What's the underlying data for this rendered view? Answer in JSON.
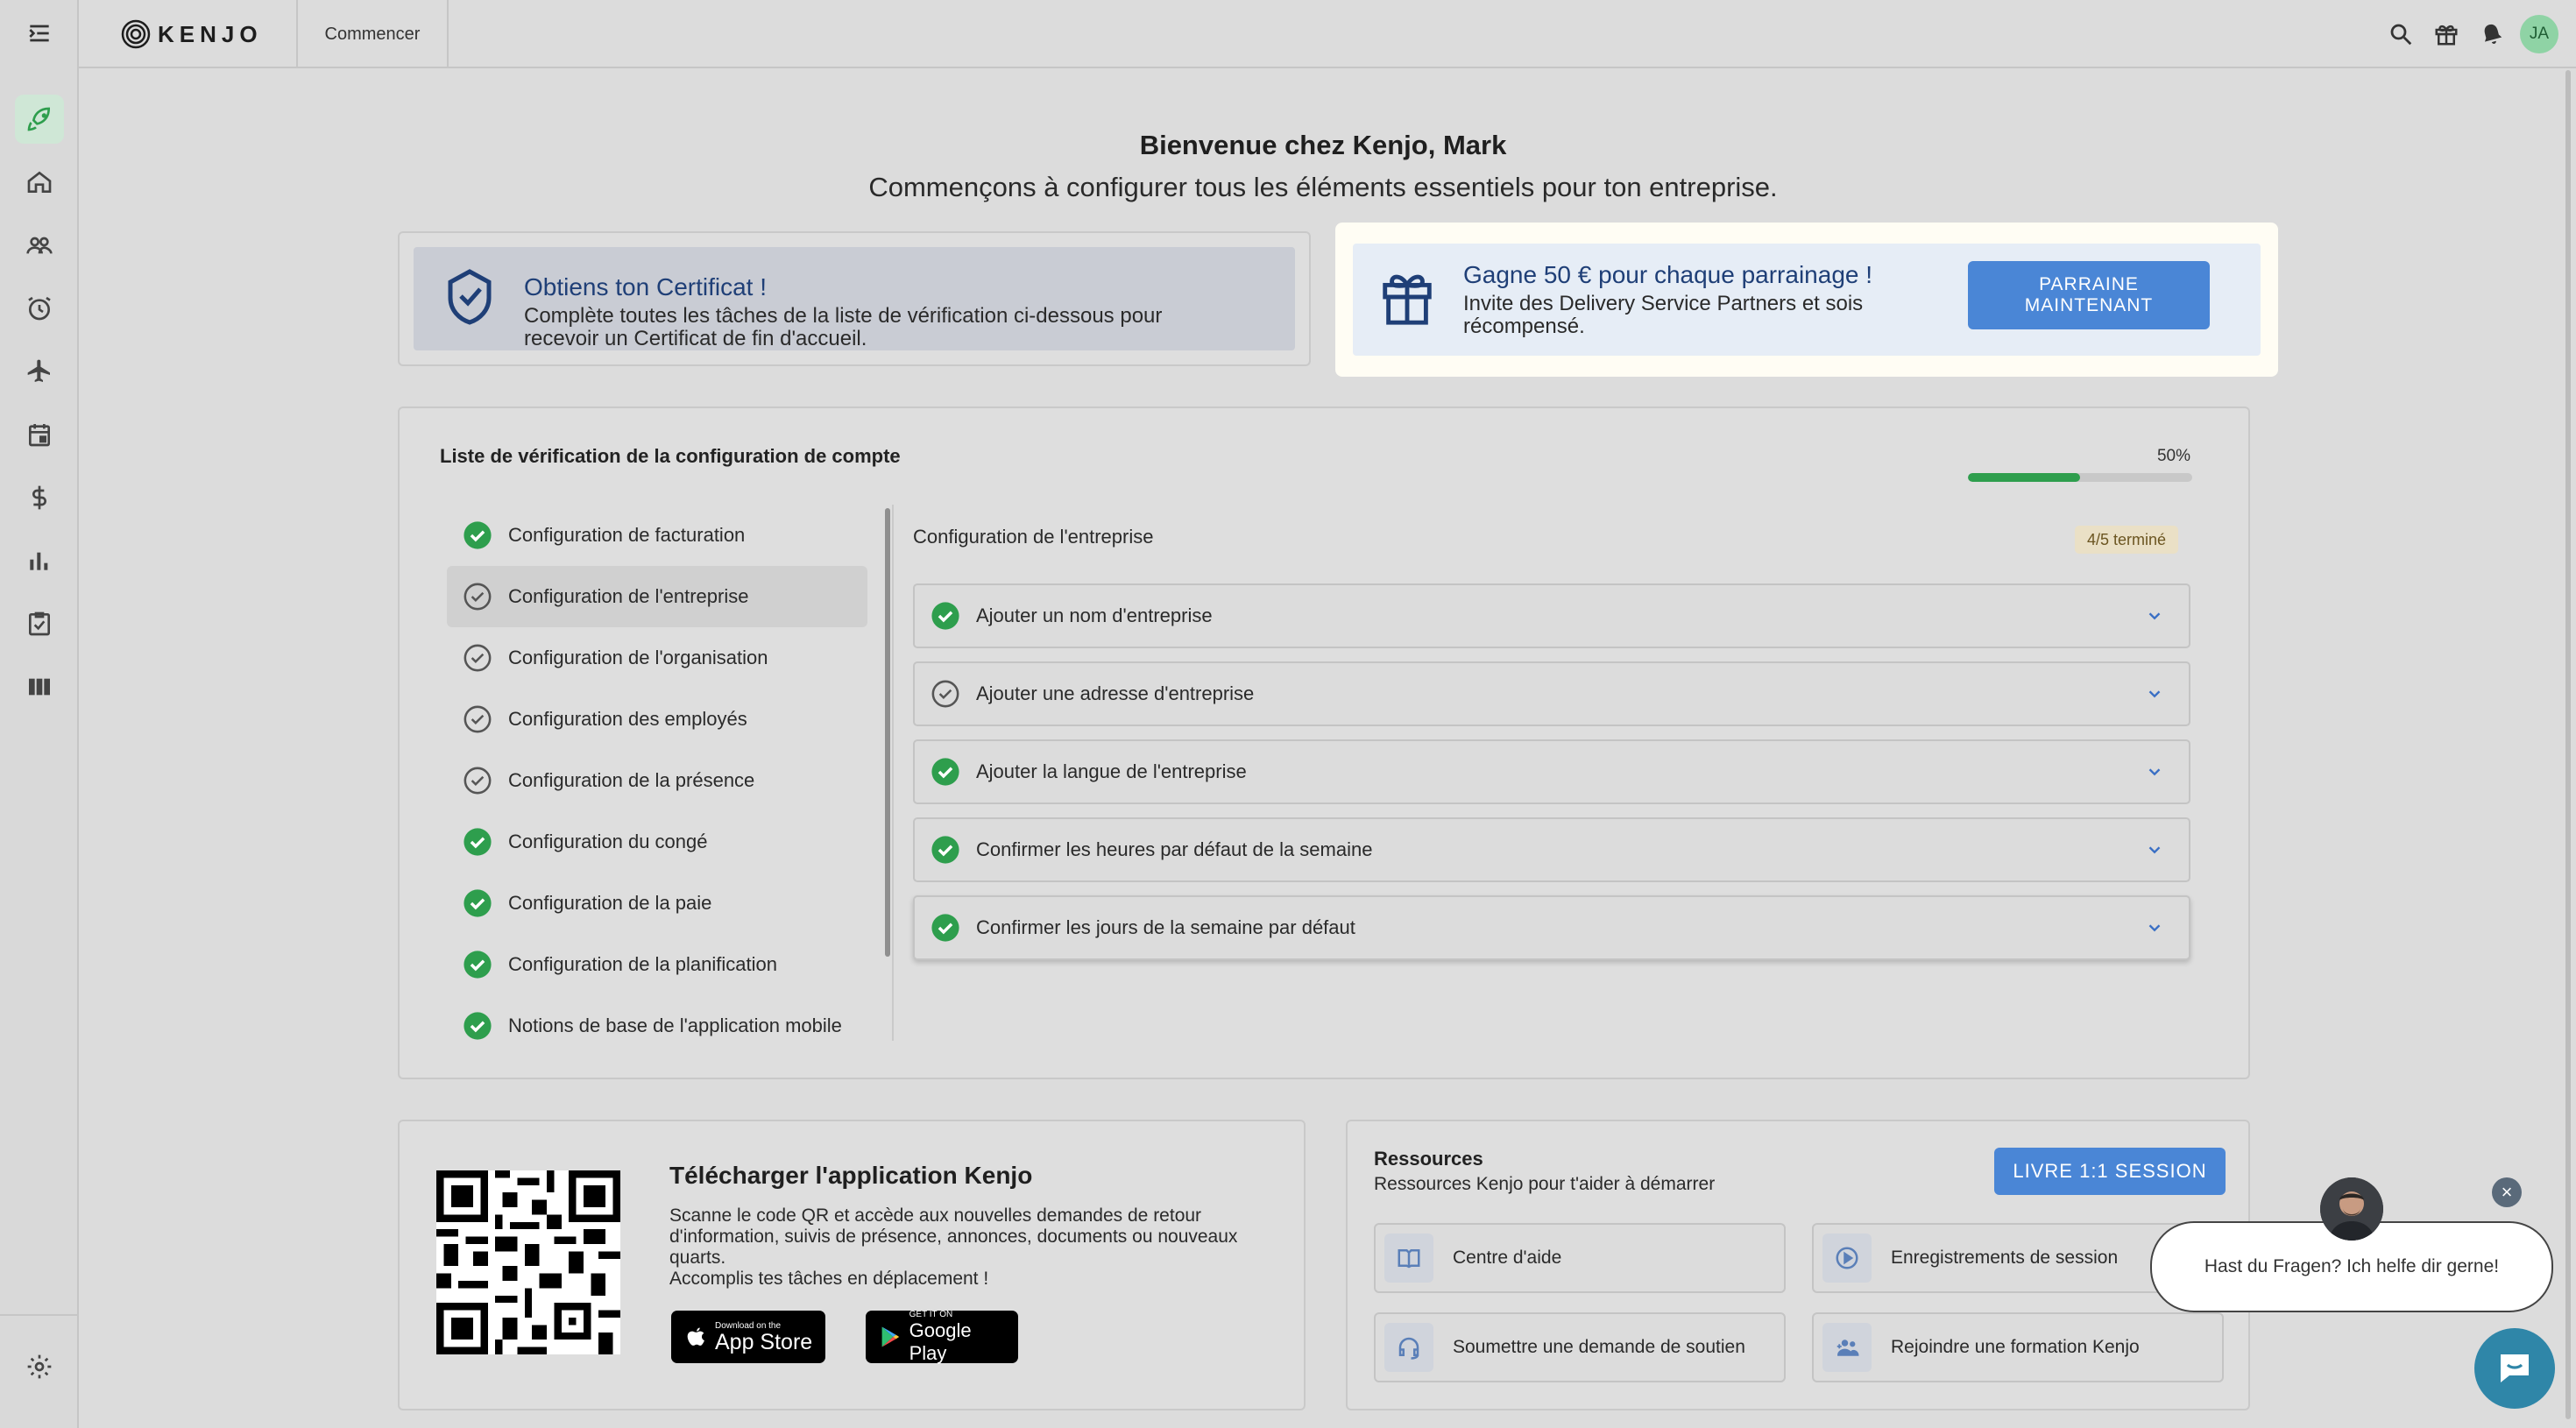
{
  "app": {
    "logo_text": "KENJO",
    "active_tab": "Commencer",
    "avatar_initials": "JA"
  },
  "icons": {
    "menu": "menu-toggle-icon",
    "rocket": "rocket-icon",
    "home": "home-icon",
    "people": "people-icon",
    "alarm": "alarm-clock-icon",
    "plane": "airplane-icon",
    "calendar": "calendar-icon",
    "dollar": "dollar-icon",
    "chart": "bar-chart-icon",
    "task": "checklist-icon",
    "columns": "columns-icon",
    "settings": "gear-icon",
    "search": "search-icon",
    "gift": "gift-icon",
    "bell": "bell-icon"
  },
  "welcome": {
    "title": "Bienvenue chez Kenjo, Mark",
    "subtitle": "Commençons à configurer tous les éléments essentiels pour ton entreprise."
  },
  "certificate": {
    "title": "Obtiens ton Certificat !",
    "description": "Complète toutes les tâches de la liste de vérification ci-dessous pour recevoir un Certificat de fin d'accueil."
  },
  "referral": {
    "title": "Gagne 50 € pour chaque parrainage !",
    "description": "Invite des Delivery Service Partners et sois récompensé.",
    "button": "PARRAINE MAINTENANT"
  },
  "checklist": {
    "title": "Liste de vérification de la configuration de compte",
    "progress_label": "50%",
    "progress_fraction": 0.5,
    "sections": [
      {
        "label": "Configuration de facturation",
        "done": true
      },
      {
        "label": "Configuration de l'entreprise",
        "done": false,
        "selected": true
      },
      {
        "label": "Configuration de l'organisation",
        "done": false
      },
      {
        "label": "Configuration des employés",
        "done": false
      },
      {
        "label": "Configuration de la présence",
        "done": false
      },
      {
        "label": "Configuration du congé",
        "done": true
      },
      {
        "label": "Configuration de la paie",
        "done": true
      },
      {
        "label": "Configuration de la planification",
        "done": true
      },
      {
        "label": "Notions de base de l'application mobile",
        "done": true
      }
    ],
    "detail": {
      "title": "Configuration de l'entreprise",
      "badge": "4/5 terminé",
      "tasks": [
        {
          "label": "Ajouter un nom d'entreprise",
          "done": true
        },
        {
          "label": "Ajouter une adresse d'entreprise",
          "done": false
        },
        {
          "label": "Ajouter la langue de l'entreprise",
          "done": true
        },
        {
          "label": "Confirmer les heures par défaut de la semaine",
          "done": true
        },
        {
          "label": "Confirmer les jours de la semaine par défaut",
          "done": true
        }
      ]
    }
  },
  "app_download": {
    "title": "Télécharger l'application Kenjo",
    "description": "Scanne le code QR et accède aux nouvelles demandes de retour d'information, suivis de présence, annonces, documents ou nouveaux quarts.",
    "description2": "Accomplis tes tâches en déplacement !",
    "appstore_small": "Download on the",
    "appstore_big": "App Store",
    "gplay_small": "GET IT ON",
    "gplay_big": "Google Play"
  },
  "resources": {
    "title": "Ressources",
    "subtitle": "Ressources Kenjo pour t'aider à démarrer",
    "button": "LIVRE 1:1 SESSION",
    "items": [
      {
        "label": "Centre d'aide",
        "icon": "book-icon"
      },
      {
        "label": "Enregistrements de session",
        "icon": "play-icon"
      },
      {
        "label": "Soumettre une demande de soutien",
        "icon": "headset-icon"
      },
      {
        "label": "Rejoindre une formation Kenjo",
        "icon": "add-users-icon"
      }
    ]
  },
  "chat": {
    "message": "Hast du Fragen? Ich helfe dir gerne!",
    "close": "×"
  },
  "colors": {
    "accent_blue": "#4a86d6",
    "success_green": "#2e9e4d",
    "rocket_green": "#2e9e4d"
  }
}
